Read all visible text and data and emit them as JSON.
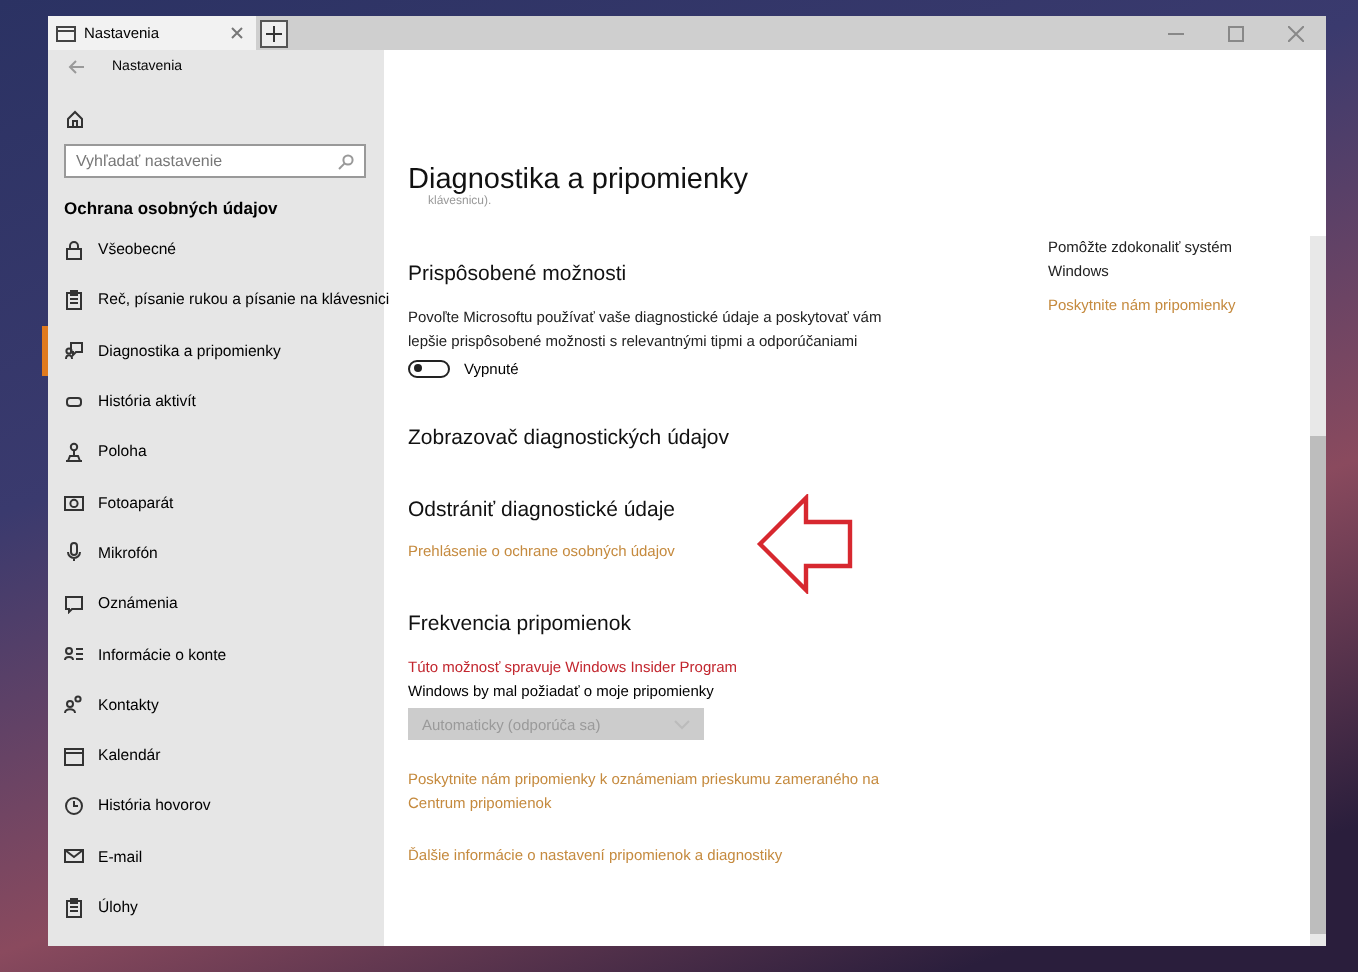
{
  "window": {
    "tab_title": "Nastavenia",
    "header_title": "Nastavenia"
  },
  "sidebar": {
    "search": {
      "placeholder": "Vyhľadať nastavenie"
    },
    "section_title": "Ochrana osobných údajov",
    "items": [
      {
        "label": "Všeobecné",
        "selected": false
      },
      {
        "label": "Reč, písanie rukou a písanie na klávesnici",
        "selected": false
      },
      {
        "label": "Diagnostika a pripomienky",
        "selected": true
      },
      {
        "label": "História aktivít",
        "selected": false
      },
      {
        "label": "Poloha",
        "selected": false
      },
      {
        "label": "Fotoaparát",
        "selected": false
      },
      {
        "label": "Mikrofón",
        "selected": false
      },
      {
        "label": "Oznámenia",
        "selected": false
      },
      {
        "label": "Informácie o konte",
        "selected": false
      },
      {
        "label": "Kontakty",
        "selected": false
      },
      {
        "label": "Kalendár",
        "selected": false
      },
      {
        "label": "História hovorov",
        "selected": false
      },
      {
        "label": "E-mail",
        "selected": false
      },
      {
        "label": "Úlohy",
        "selected": false
      }
    ]
  },
  "content": {
    "title": "Diagnostika a pripomienky",
    "clipped_text": "klávesnicu).",
    "tailored": {
      "heading": "Prispôsobené možnosti",
      "description": "Povoľte Microsoftu používať vaše diagnostické údaje a poskytovať vám lepšie prispôsobené možnosti s relevantnými tipmi a odporúčaniami",
      "toggle": {
        "on": false,
        "label": "Vypnuté"
      }
    },
    "viewer_heading": "Zobrazovač diagnostických údajov",
    "delete": {
      "heading": "Odstrániť diagnostické údaje",
      "link": "Prehlásenie o ochrane osobných údajov"
    },
    "frequency": {
      "heading": "Frekvencia pripomienok",
      "notice": "Túto možnosť spravuje Windows Insider Program",
      "label": "Windows by mal požiadať o moje pripomienky",
      "dropdown": {
        "value": "Automaticky (odporúča sa)",
        "disabled": true
      },
      "links": [
        "Poskytnite nám pripomienky k oznámeniam prieskumu zameraného na Centrum pripomienok",
        "Ďalšie informácie o nastavení pripomienok a diagnostiky"
      ]
    }
  },
  "related": {
    "text": "Pomôžte zdokonaliť systém Windows",
    "link": "Poskytnite nám pripomienky"
  }
}
